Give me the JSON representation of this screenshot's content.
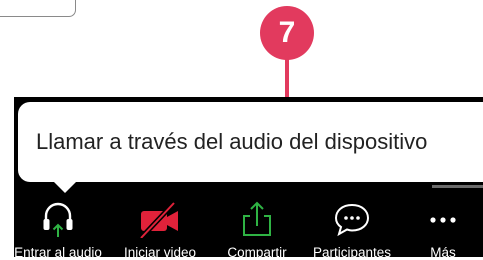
{
  "step_badge": "7",
  "tooltip": {
    "text": "Llamar a través del audio del dispositivo"
  },
  "toolbar": {
    "items": [
      {
        "label": "Entrar al audio",
        "icon": "headphones-arrow-icon"
      },
      {
        "label": "Iniciar video",
        "icon": "video-off-icon"
      },
      {
        "label": "Compartir",
        "icon": "share-icon"
      },
      {
        "label": "Participantes",
        "icon": "chat-bubble-icon"
      },
      {
        "label": "Más",
        "icon": "more-dots-icon"
      }
    ]
  },
  "colors": {
    "accent": "#e23a5e",
    "toolbar_bg": "#000000",
    "icon_green": "#2fb344",
    "icon_red": "#e0223a",
    "icon_white": "#ffffff"
  }
}
